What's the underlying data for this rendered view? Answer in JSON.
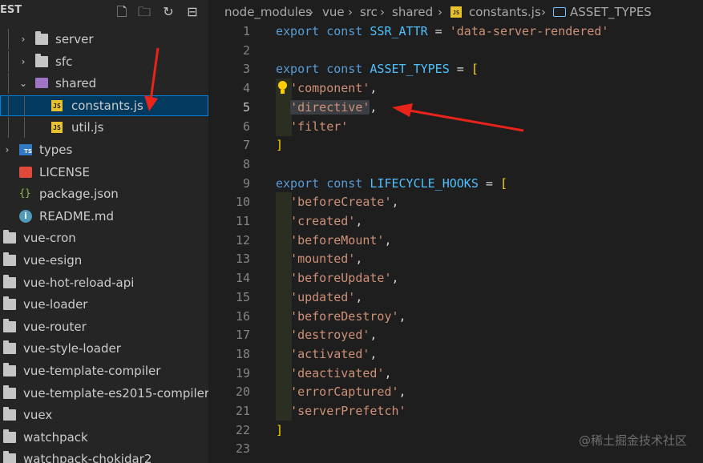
{
  "sidebar": {
    "title": "EST",
    "header_actions": [
      "new-file-icon",
      "new-folder-icon",
      "refresh-icon",
      "collapse-all-icon"
    ],
    "items": [
      {
        "label": "server",
        "type": "folder",
        "expanded": false
      },
      {
        "label": "sfc",
        "type": "folder",
        "expanded": false
      },
      {
        "label": "shared",
        "type": "folder",
        "expanded": true
      },
      {
        "label": "constants.js",
        "type": "js-file",
        "selected": true
      },
      {
        "label": "util.js",
        "type": "js-file"
      },
      {
        "label": "types",
        "type": "ts-folder",
        "expanded": false
      },
      {
        "label": "LICENSE",
        "type": "license-file"
      },
      {
        "label": "package.json",
        "type": "json-file"
      },
      {
        "label": "README.md",
        "type": "info-file"
      },
      {
        "label": "vue-cron",
        "type": "folder"
      },
      {
        "label": "vue-esign",
        "type": "folder"
      },
      {
        "label": "vue-hot-reload-api",
        "type": "folder"
      },
      {
        "label": "vue-loader",
        "type": "folder"
      },
      {
        "label": "vue-router",
        "type": "folder"
      },
      {
        "label": "vue-style-loader",
        "type": "folder"
      },
      {
        "label": "vue-template-compiler",
        "type": "folder"
      },
      {
        "label": "vue-template-es2015-compiler",
        "type": "folder"
      },
      {
        "label": "vuex",
        "type": "folder"
      },
      {
        "label": "watchpack",
        "type": "folder"
      },
      {
        "label": "watchpack-chokidar2",
        "type": "folder"
      }
    ]
  },
  "breadcrumb": {
    "items": [
      "node_modules",
      "vue",
      "src",
      "shared",
      "constants.js",
      "ASSET_TYPES"
    ]
  },
  "editor": {
    "active_line": 5,
    "lines": [
      {
        "n": "1",
        "tokens": [
          [
            "kw",
            "export"
          ],
          [
            "op",
            " "
          ],
          [
            "kw",
            "const"
          ],
          [
            "op",
            " "
          ],
          [
            "cn",
            "SSR_ATTR"
          ],
          [
            "op",
            " = "
          ],
          [
            "str",
            "'data-server-rendered'"
          ]
        ]
      },
      {
        "n": "2",
        "tokens": []
      },
      {
        "n": "3",
        "tokens": [
          [
            "kw",
            "export"
          ],
          [
            "op",
            " "
          ],
          [
            "kw",
            "const"
          ],
          [
            "op",
            " "
          ],
          [
            "cn",
            "ASSET_TYPES"
          ],
          [
            "op",
            " = "
          ],
          [
            "br",
            "["
          ]
        ]
      },
      {
        "n": "4",
        "tokens": [
          [
            "str",
            "'component'"
          ],
          [
            "op",
            ","
          ]
        ],
        "indent": true,
        "bulb": true
      },
      {
        "n": "5",
        "tokens": [
          [
            "str",
            "'directive'"
          ],
          [
            "op",
            ","
          ]
        ],
        "indent": true,
        "highlight": true
      },
      {
        "n": "6",
        "tokens": [
          [
            "str",
            "'filter'"
          ]
        ],
        "indent": true
      },
      {
        "n": "7",
        "tokens": [
          [
            "br",
            "]"
          ]
        ]
      },
      {
        "n": "8",
        "tokens": []
      },
      {
        "n": "9",
        "tokens": [
          [
            "kw",
            "export"
          ],
          [
            "op",
            " "
          ],
          [
            "kw",
            "const"
          ],
          [
            "op",
            " "
          ],
          [
            "cn",
            "LIFECYCLE_HOOKS"
          ],
          [
            "op",
            " = "
          ],
          [
            "br",
            "["
          ]
        ]
      },
      {
        "n": "10",
        "tokens": [
          [
            "str",
            "'beforeCreate'"
          ],
          [
            "op",
            ","
          ]
        ],
        "indent": true
      },
      {
        "n": "11",
        "tokens": [
          [
            "str",
            "'created'"
          ],
          [
            "op",
            ","
          ]
        ],
        "indent": true
      },
      {
        "n": "12",
        "tokens": [
          [
            "str",
            "'beforeMount'"
          ],
          [
            "op",
            ","
          ]
        ],
        "indent": true
      },
      {
        "n": "13",
        "tokens": [
          [
            "str",
            "'mounted'"
          ],
          [
            "op",
            ","
          ]
        ],
        "indent": true
      },
      {
        "n": "14",
        "tokens": [
          [
            "str",
            "'beforeUpdate'"
          ],
          [
            "op",
            ","
          ]
        ],
        "indent": true
      },
      {
        "n": "15",
        "tokens": [
          [
            "str",
            "'updated'"
          ],
          [
            "op",
            ","
          ]
        ],
        "indent": true
      },
      {
        "n": "16",
        "tokens": [
          [
            "str",
            "'beforeDestroy'"
          ],
          [
            "op",
            ","
          ]
        ],
        "indent": true
      },
      {
        "n": "17",
        "tokens": [
          [
            "str",
            "'destroyed'"
          ],
          [
            "op",
            ","
          ]
        ],
        "indent": true
      },
      {
        "n": "18",
        "tokens": [
          [
            "str",
            "'activated'"
          ],
          [
            "op",
            ","
          ]
        ],
        "indent": true
      },
      {
        "n": "19",
        "tokens": [
          [
            "str",
            "'deactivated'"
          ],
          [
            "op",
            ","
          ]
        ],
        "indent": true
      },
      {
        "n": "20",
        "tokens": [
          [
            "str",
            "'errorCaptured'"
          ],
          [
            "op",
            ","
          ]
        ],
        "indent": true
      },
      {
        "n": "21",
        "tokens": [
          [
            "str",
            "'serverPrefetch'"
          ]
        ],
        "indent": true
      },
      {
        "n": "22",
        "tokens": [
          [
            "br",
            "]"
          ]
        ]
      },
      {
        "n": "23",
        "tokens": []
      }
    ]
  },
  "watermark": "@稀土掘金技术社区",
  "colors": {
    "keyword": "#569cd6",
    "constant": "#4fc1ff",
    "string": "#ce9178",
    "bracket": "#ffd700",
    "selection": "#04395e",
    "annotation_arrow": "#e8231a"
  }
}
